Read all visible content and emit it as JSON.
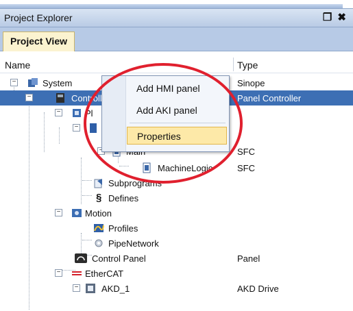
{
  "panel": {
    "title": "Project Explorer",
    "window_buttons": "❐ ✖"
  },
  "tabs": [
    {
      "label": "Project View"
    }
  ],
  "columns": {
    "name": "Name",
    "type": "Type"
  },
  "tree": [
    {
      "label": "System",
      "type": "Sinope"
    },
    {
      "label": "Controller",
      "type": "Panel Controller"
    },
    {
      "label": "Pl",
      "type": ""
    },
    {
      "label": "",
      "type": ""
    },
    {
      "label": "Main",
      "type": "SFC"
    },
    {
      "label": "MachineLogic",
      "type": "SFC"
    },
    {
      "label": "Subprograms",
      "type": ""
    },
    {
      "label": "Defines",
      "type": ""
    },
    {
      "label": "Motion",
      "type": ""
    },
    {
      "label": "Profiles",
      "type": ""
    },
    {
      "label": "PipeNetwork",
      "type": ""
    },
    {
      "label": "Control Panel",
      "type": "Panel"
    },
    {
      "label": "EtherCAT",
      "type": ""
    },
    {
      "label": "AKD_1",
      "type": "AKD Drive"
    }
  ],
  "context_menu": {
    "items": [
      {
        "label": "Add HMI panel"
      },
      {
        "label": "Add AKI panel"
      },
      {
        "label": "Properties"
      }
    ]
  },
  "colors": {
    "selection": "#3d6fb4",
    "highlight_ring": "#e0202e",
    "menu_hover": "#fde9a8"
  }
}
